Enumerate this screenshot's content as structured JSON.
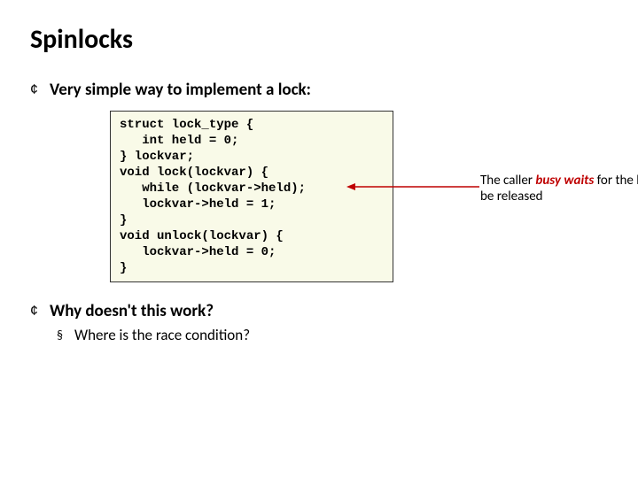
{
  "title": "Spinlocks",
  "bullets": {
    "b1": {
      "glyph": "¢",
      "text": "Very simple way to implement a lock:"
    },
    "b2": {
      "glyph": "¢",
      "text": "Why doesn't this work?"
    },
    "sub1": {
      "glyph": "§",
      "text": "Where is the race condition?"
    }
  },
  "code": "struct lock_type {\n   int held = 0;\n} lockvar;\nvoid lock(lockvar) {\n   while (lockvar->held);\n   lockvar->held = 1;\n}\nvoid unlock(lockvar) {\n   lockvar->held = 0;\n}",
  "annotation": {
    "pre": "The caller ",
    "busy_waits": "busy waits",
    "post": " for the lock to be released"
  }
}
